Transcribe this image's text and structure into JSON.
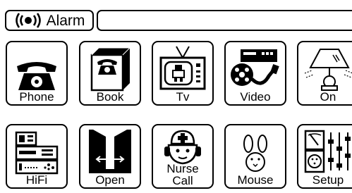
{
  "alarm": {
    "label": "Alarm",
    "icon": "alarm-broadcast-icon"
  },
  "message": {
    "value": ""
  },
  "tiles": [
    {
      "label": "Phone",
      "icon": "telephone-icon"
    },
    {
      "label": "Book",
      "icon": "phone-book-icon"
    },
    {
      "label": "Tv",
      "icon": "television-icon"
    },
    {
      "label": "Video",
      "icon": "video-recorder-icon"
    },
    {
      "label": "On",
      "icon": "lamp-icon"
    },
    {
      "label": "HiFi",
      "icon": "hifi-stereo-icon"
    },
    {
      "label": "Open",
      "icon": "door-open-icon"
    },
    {
      "label": "Nurse Call",
      "label_line1": "Nurse",
      "label_line2": "Call",
      "icon": "nurse-icon"
    },
    {
      "label": "Mouse",
      "icon": "mouse-icon"
    },
    {
      "label": "Setup",
      "icon": "setup-panel-icon"
    }
  ]
}
